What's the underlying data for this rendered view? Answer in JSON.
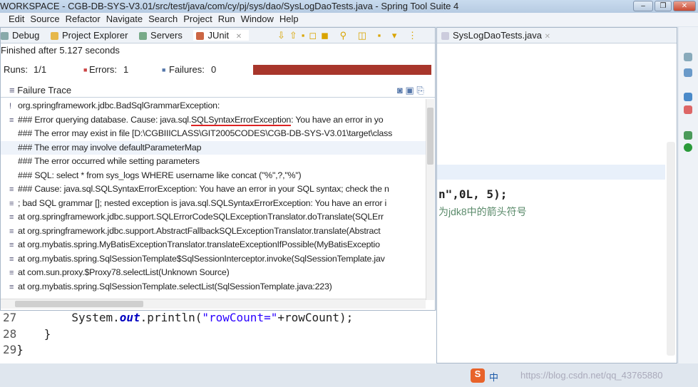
{
  "window": {
    "title": "WORKSPACE - CGB-DB-SYS-V3.01/src/test/java/com/cy/pj/sys/dao/SysLogDaoTests.java - Spring Tool Suite 4",
    "controls": [
      "–",
      "❐",
      "✕"
    ]
  },
  "menu": [
    "Edit",
    "Source",
    "Refactor",
    "Navigate",
    "Search",
    "Project",
    "Run",
    "Window",
    "Help"
  ],
  "views": {
    "tabs": [
      "Debug",
      "Project Explorer",
      "Servers",
      "JUnit"
    ]
  },
  "junit": {
    "status": "Finished after 5.127 seconds",
    "runs_label": "Runs:",
    "runs": "1/1",
    "errors_label": "Errors:",
    "errors": "1",
    "failures_label": "Failures:",
    "failures": "0",
    "progress": 1.0,
    "bar_color": "#a8362b",
    "failure_trace_label": "Failure Trace",
    "trace": [
      "org.springframework.jdbc.BadSqlGrammarException:",
      "### Error querying database.  Cause: java.sql.SQLSyntaxErrorException: You have an error in yo",
      "### The error may exist in file [D:\\CGBIIICLASS\\GIT2005CODES\\CGB-DB-SYS-V3.01\\target\\class",
      "### The error may involve defaultParameterMap",
      "### The error occurred while setting parameters",
      "### SQL: select *                from sys_logs          WHERE username like concat (\"%\",?,\"%\")",
      "### Cause: java.sql.SQLSyntaxErrorException: You have an error in your SQL syntax; check the n",
      "; bad SQL grammar []; nested exception is java.sql.SQLSyntaxErrorException: You have an error i",
      "at org.springframework.jdbc.support.SQLErrorCodeSQLExceptionTranslator.doTranslate(SQLErr",
      "at org.springframework.jdbc.support.AbstractFallbackSQLExceptionTranslator.translate(Abstract",
      "at org.mybatis.spring.MyBatisExceptionTranslator.translateExceptionIfPossible(MyBatisExceptio",
      "at org.mybatis.spring.SqlSessionTemplate$SqlSessionInterceptor.invoke(SqlSessionTemplate.jav",
      "at com.sun.proxy.$Proxy78.selectList(Unknown Source)",
      "at org.mybatis.spring.SqlSessionTemplate.selectList(SqlSessionTemplate.java:223)"
    ]
  },
  "editor": {
    "tab": "SysLogDaoTests.java",
    "partial_line": "n\",0L, 5);",
    "comment": "为jdk8中的箭头符号",
    "lines": [
      {
        "num": "27",
        "code": "        System.out.println(\"rowCount=\"+rowCount);"
      },
      {
        "num": "28",
        "code": "    }"
      },
      {
        "num": "29",
        "code": "}"
      }
    ]
  },
  "watermark": "https://blog.csdn.net/qq_43765880",
  "ime": {
    "label": "中"
  }
}
